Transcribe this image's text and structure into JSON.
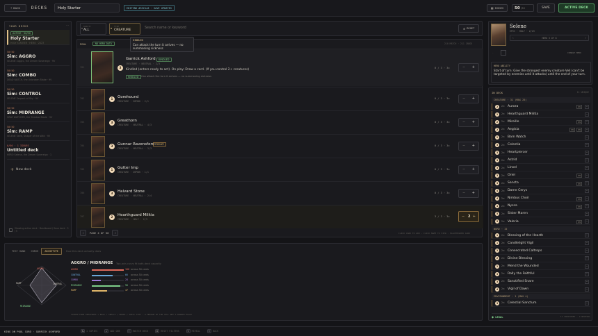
{
  "topbar": {
    "back_label": "BACK",
    "section_label": "DECKS",
    "deck_name": "Holy Starter",
    "editing_label": "EDITING #5321c8 · SAVE UPDATES",
    "mode_label": "MODES",
    "deck_count": "50",
    "deck_count_suffix": "/50",
    "save_label": "SAVE",
    "active_label": "ACTIVE DECK"
  },
  "sidebar": {
    "title": "YOUR DECKS",
    "decks": [
      {
        "tag": "ACTIVE · 50/50",
        "name": "Holy Starter",
        "sub": "HOLY STARTER · HERO · 2023"
      },
      {
        "tag": "50/50",
        "name": "Sim: AGGRO",
        "sub": "SELENE: Aggro, the Dream Sovereign · 9V"
      },
      {
        "tag": "50/50",
        "name": "Sim: COMBO",
        "sub": "DEAD WATCH, the Unbroken Blade · 9V"
      },
      {
        "tag": "50/50",
        "name": "Sim: CONTROL",
        "sub": "SELENE Serpent of Sky · 9V"
      },
      {
        "tag": "50/50",
        "name": "Sim: MIDRANGE",
        "sub": "GRAY WATCHER, the Shadow Blade · 9V"
      },
      {
        "tag": "50/50",
        "name": "Sim: RAMP",
        "sub": "SELENE Seed, Shaper of the Wild · 9V"
      },
      {
        "tag": "0/50 · 1 ISSUES",
        "name": "Untitled deck",
        "sub": "HERO Selene, the Dream Sovereign · 1"
      }
    ],
    "new_deck_label": "New deck",
    "footer_note": "Showing active deck · Dashboard / Save deck · 3 / 5"
  },
  "filters": {
    "rarity_caption": "RARITY",
    "rarity_value": "ALL",
    "type_caption": "TYPE",
    "type_value": "CREATURE",
    "search_placeholder": "Search name or keyword",
    "reset_label": "RESET"
  },
  "tooltip": {
    "keyword": "KINDLED",
    "text": "Can attack the turn it arrives — no summoning sickness"
  },
  "pool": {
    "label": "POOL",
    "hero_badge": "NO HERO DATA",
    "pagination_label": "PAGE 4 OF 50",
    "count_note": "210 MATCH · 211 CARDS",
    "footer_hint": "CLICK CARD TO ADD · CLICK NAME TO VIEW · PLACEHOLDER CARD",
    "featured": {
      "name": "Garrick Ashford",
      "keyword": "KINDLED",
      "type": "CREATURE · NEUTRAL · 2/3",
      "text": "Kindled (enters ready to act). On play: Draw a card. (If you control 2+ creatures)",
      "keyword_line": "KINDLED",
      "keyword_desc": "Can attack the turn it arrives — no summoning sickness",
      "cost": "3",
      "qty": "0 / 3 · 3x",
      "index": "701"
    },
    "cards": [
      {
        "name": "Gorehound",
        "type": "CREATURE · DEMON · 2/1",
        "cost": "1",
        "qty": "0 / 3 · 3x",
        "index": "702"
      },
      {
        "name": "Greathorn",
        "type": "CREATURE · NEUTRAL · 4/3",
        "cost": "3",
        "qty": "0 / 3 · 3x",
        "index": "703"
      },
      {
        "name": "Gunnar Ravensford",
        "type": "CREATURE · NEUTRAL · 3/3",
        "cost": "3",
        "qty": "0 / 3 · 3x",
        "index": "704",
        "keyword": "FRENZY"
      },
      {
        "name": "Gutter Imp",
        "type": "CREATURE · DEMON · 1/1",
        "cost": "1",
        "qty": "0 / 3 · 3x",
        "index": "705"
      },
      {
        "name": "Halvard Stone",
        "type": "CREATURE · NEUTRAL · 2/4",
        "cost": "3",
        "qty": "0 / 3 · 3x",
        "index": "706"
      },
      {
        "name": "Hearthguard Militia",
        "type": "CREATURE · HOLY · 2/3",
        "cost": "2",
        "qty": "3 / 3 · 3x",
        "index": "707",
        "in_deck": "2"
      }
    ]
  },
  "bottom": {
    "tabs": [
      "TEST HAND",
      "CURVE",
      "ARCHETYPE"
    ],
    "tab_hint": "How this deck actually does",
    "radar_labels": {
      "aggro": "AGGRO",
      "control": "CONTROL",
      "ramp": "RAMP",
      "midrange": "MIDRANGE"
    },
    "archetype_title": "AGGRO / MIDRANGE",
    "archetype_sub": "Two-axis curvy fit both-deck capacity",
    "rows": [
      {
        "name": "AGGRO",
        "score": 100,
        "score_text": "100",
        "desc": "across 50 cards",
        "color": "#e06a5a"
      },
      {
        "name": "CONTROL",
        "score": 66,
        "score_text": "66",
        "desc": "across 50 cards",
        "color": "#6aa7d8"
      },
      {
        "name": "COMBO",
        "score": 28,
        "score_text": "28",
        "desc": "across 50 cards",
        "color": "#a07ad8"
      },
      {
        "name": "MIDRANGE",
        "score": 90,
        "score_text": "90",
        "desc": "across 50 cards",
        "color": "#7fd08a"
      },
      {
        "name": "RAMP",
        "score": 47,
        "score_text": "47",
        "desc": "across 50 cards",
        "color": "#e2b86a"
      }
    ],
    "footnote": "SCORED FROM CREATURES + BIAS / SPELLS / WORDS / SPELL TEXT · A MEDIUM OF THE CELL NOT A RANKED PLACE"
  },
  "hero": {
    "name": "Selene",
    "stats": "EPIC · HOLY · 2/23",
    "nav_label": "HERO 3 OF 8",
    "swap_label": "CHANGE HERO",
    "ability_caption": "HERO ABILITY",
    "ability_text": "Start of turn: Give the strongest enemy creature Veil (can't be targeted by enemies until it attacks) until the end of your turn."
  },
  "indeck": {
    "title": "IN DECK",
    "count": "11 UNIQUE",
    "sections": [
      {
        "label": "CREATURE · 31   (MAX 25)",
        "items": [
          {
            "cost": "2",
            "qty": "2×",
            "name": "Aurora",
            "tags": [
              "S5"
            ]
          },
          {
            "cost": "2",
            "qty": "2×",
            "name": "Hearthguard Militia",
            "tags": []
          },
          {
            "cost": "2",
            "qty": "2×",
            "name": "Mireille",
            "tags": [
              "S5"
            ]
          },
          {
            "cost": "2",
            "qty": "2×",
            "name": "Aegisia",
            "tags": [
              "S5",
              "S5"
            ]
          },
          {
            "cost": "2",
            "qty": "2×",
            "name": "Barn Watch",
            "tags": []
          },
          {
            "cost": "3",
            "qty": "2×",
            "name": "Celestia",
            "tags": []
          },
          {
            "cost": "3",
            "qty": "2×",
            "name": "Heartpiercer",
            "tags": []
          },
          {
            "cost": "3",
            "qty": "2×",
            "name": "Astrid",
            "tags": []
          },
          {
            "cost": "3",
            "qty": "2×",
            "name": "Linsel",
            "tags": []
          },
          {
            "cost": "3",
            "qty": "2×",
            "name": "Oriel",
            "tags": [
              "S5"
            ]
          },
          {
            "cost": "3",
            "qty": "2×",
            "name": "Sancta",
            "tags": [
              "S5"
            ]
          },
          {
            "cost": "4",
            "qty": "2×",
            "name": "Dame Cerys",
            "tags": []
          },
          {
            "cost": "4",
            "qty": "2×",
            "name": "Nimbus Choir",
            "tags": [
              "S5"
            ]
          },
          {
            "cost": "4",
            "qty": "2×",
            "name": "Nyssa",
            "tags": [
              "S5"
            ]
          },
          {
            "cost": "5",
            "qty": "2×",
            "name": "Sister Maren",
            "tags": []
          },
          {
            "cost": "5",
            "qty": "2×",
            "name": "Valeria",
            "tags": [
              "S5"
            ]
          }
        ]
      },
      {
        "label": "WORD · 15",
        "items": [
          {
            "cost": "1",
            "qty": "2×",
            "name": "Blessing of the Hearth",
            "tags": []
          },
          {
            "cost": "1",
            "qty": "2×",
            "name": "Candlelight Vigil",
            "tags": []
          },
          {
            "cost": "2",
            "qty": "2×",
            "name": "Consecrated Caltrops",
            "tags": []
          },
          {
            "cost": "2",
            "qty": "2×",
            "name": "Divine Blessing",
            "tags": []
          },
          {
            "cost": "2",
            "qty": "2×",
            "name": "Mend the Wounded",
            "tags": []
          },
          {
            "cost": "3",
            "qty": "2×",
            "name": "Rally the Faithful",
            "tags": []
          },
          {
            "cost": "3",
            "qty": "2×",
            "name": "Sanctified Snare",
            "tags": []
          },
          {
            "cost": "4",
            "qty": "2×",
            "name": "Vigil of Dawn",
            "tags": []
          }
        ]
      },
      {
        "label": "ENVIRONMENT · 1   (MAX 4)",
        "items": [
          {
            "cost": "3",
            "qty": "2×",
            "name": "Celestial Sanctum",
            "tags": []
          }
        ]
      }
    ],
    "legal_label": "LEGAL",
    "legal_note": "11 CREATURES · 4 NEUTRAL"
  },
  "status": {
    "hint": "KING ON POOL CARD · GARRICK ASHFORD",
    "items": [
      "1 COPIES",
      "ADD ONE",
      "SWITCH DECK",
      "RESET FILTERS",
      "REVEAL",
      "BACK"
    ]
  }
}
